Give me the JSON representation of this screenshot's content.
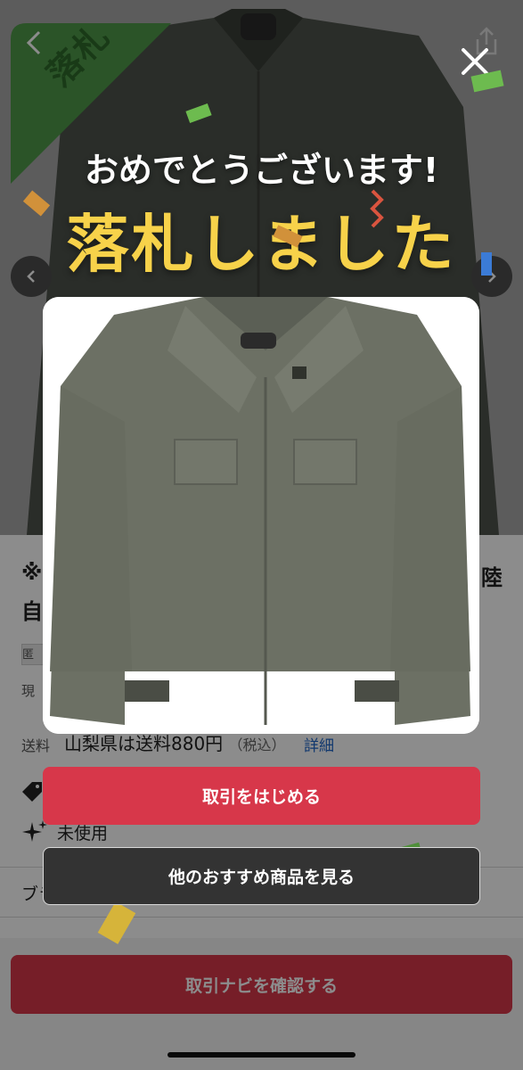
{
  "overlay": {
    "congrats_text": "おめでとうございます!",
    "won_heading": "落札しました",
    "start_trade_label": "取引をはじめる",
    "see_more_label": "他のおすすめ商品を見る",
    "close_icon": "close-icon"
  },
  "listing": {
    "won_ribbon": "落札",
    "title_prefix": "※",
    "title_line1_end": "陸",
    "title_line2_start": "自",
    "tag_start": "匿",
    "price_label_start": "現",
    "shipping_label": "送料",
    "shipping_text": "山梨県は送料880円",
    "shipping_tax": "（税込）",
    "shipping_detail_link": "詳細",
    "condition": "未使用",
    "open_in_browser": "ブラウザで開く",
    "confirm_navi_label": "取引ナビを確認する"
  },
  "colors": {
    "accent_red": "#d7374a",
    "won_yellow": "#f7d24a",
    "ribbon_green": "#2e6a2a"
  }
}
